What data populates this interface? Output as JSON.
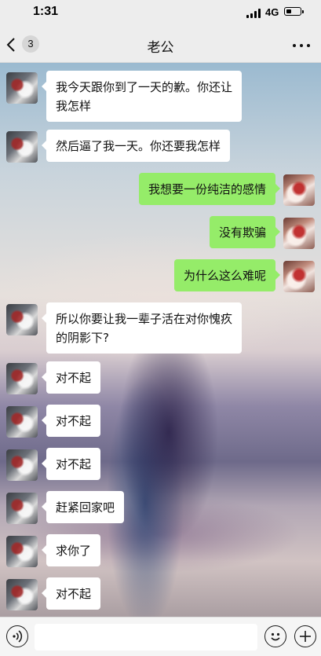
{
  "status_bar": {
    "time": "1:31",
    "network": "4G"
  },
  "nav": {
    "unread_count": "3",
    "title": "老公"
  },
  "messages": [
    {
      "side": "in",
      "lines": [
        "我今天跟你到了一天的歉。你还让",
        "我怎样"
      ]
    },
    {
      "side": "in",
      "lines": [
        "然后逼了我一天。你还要我怎样"
      ]
    },
    {
      "side": "out",
      "lines": [
        "我想要一份纯洁的感情"
      ]
    },
    {
      "side": "out",
      "lines": [
        "没有欺骗"
      ]
    },
    {
      "side": "out",
      "lines": [
        "为什么这么难呢"
      ]
    },
    {
      "side": "in",
      "lines": [
        "所以你要让我一辈子活在对你愧疚",
        "的阴影下?"
      ]
    },
    {
      "side": "in",
      "lines": [
        "对不起"
      ]
    },
    {
      "side": "in",
      "lines": [
        "对不起"
      ]
    },
    {
      "side": "in",
      "lines": [
        "对不起"
      ]
    },
    {
      "side": "in",
      "lines": [
        "赶紧回家吧"
      ]
    },
    {
      "side": "in",
      "lines": [
        "求你了"
      ]
    },
    {
      "side": "in",
      "lines": [
        "对不起"
      ]
    }
  ],
  "input_bar": {
    "voice_icon": "voice-icon",
    "emoji_icon": "emoji-icon",
    "plus_icon": "plus-icon"
  },
  "colors": {
    "bubble_in": "#ffffff",
    "bubble_out": "#95ec69",
    "bar_bg": "#ededed"
  }
}
